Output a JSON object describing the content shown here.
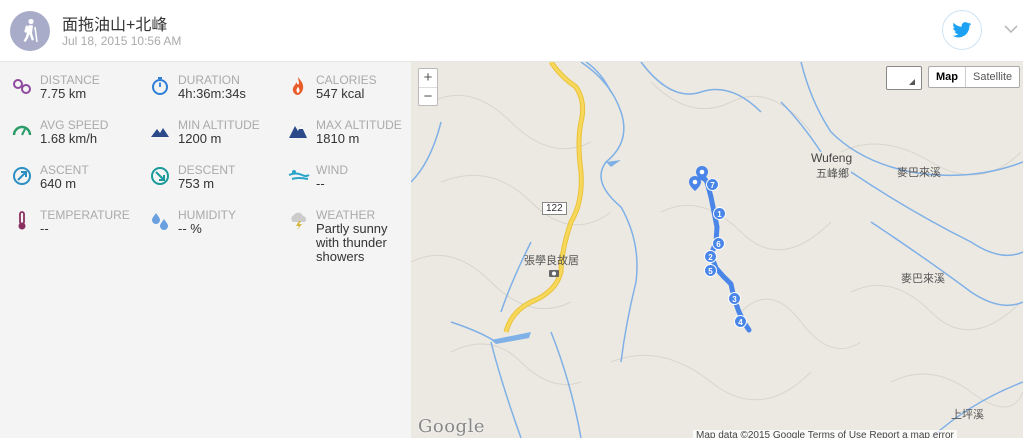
{
  "header": {
    "title": "面拖油山+北峰",
    "datetime": "Jul 18, 2015 10:56 AM",
    "avatar_icon": "hiker-icon",
    "share_icon": "twitter-icon",
    "menu_icon": "chevron-down-icon",
    "twitter_color": "#1da1f2"
  },
  "stats": [
    {
      "key": "distance",
      "label": "DISTANCE",
      "value": "7.75 km",
      "icon": "route-icon",
      "color": "#8e4a9e"
    },
    {
      "key": "duration",
      "label": "DURATION",
      "value": "4h:36m:34s",
      "icon": "stopwatch-icon",
      "color": "#2f7fd6"
    },
    {
      "key": "calories",
      "label": "CALORIES",
      "value": "547 kcal",
      "icon": "flame-icon",
      "color": "#e85d2a"
    },
    {
      "key": "avg_speed",
      "label": "AVG SPEED",
      "value": "1.68 km/h",
      "icon": "speedometer-icon",
      "color": "#2a9d6a"
    },
    {
      "key": "min_altitude",
      "label": "MIN ALTITUDE",
      "value": "1200 m",
      "icon": "mountain-low-icon",
      "color": "#2c4a8a"
    },
    {
      "key": "max_altitude",
      "label": "MAX ALTITUDE",
      "value": "1810 m",
      "icon": "mountain-high-icon",
      "color": "#2c4a8a"
    },
    {
      "key": "ascent",
      "label": "ASCENT",
      "value": "640 m",
      "icon": "ascent-icon",
      "color": "#2a8fc2"
    },
    {
      "key": "descent",
      "label": "DESCENT",
      "value": "753 m",
      "icon": "descent-icon",
      "color": "#1a9a9a"
    },
    {
      "key": "wind",
      "label": "WIND",
      "value": "--",
      "icon": "wind-icon",
      "color": "#2aa5c8"
    },
    {
      "key": "temperature",
      "label": "TEMPERATURE",
      "value": "--",
      "icon": "thermometer-icon",
      "color": "#8a3060"
    },
    {
      "key": "humidity",
      "label": "HUMIDITY",
      "value": "-- %",
      "icon": "humidity-icon",
      "color": "#6aa0e0"
    },
    {
      "key": "weather",
      "label": "WEATHER",
      "value": "Partly sunny with thunder showers",
      "icon": "thunder-cloud-icon",
      "color": "#d4b540"
    }
  ],
  "map": {
    "zoom_in": "+",
    "zoom_out": "−",
    "map_type_active": "Map",
    "map_type_other": "Satellite",
    "route_number": "122",
    "places": {
      "wufeng_en": "Wufeng",
      "wufeng_zh": "五峰鄉",
      "river1": "麥巴來溪",
      "river2": "麥巴來溪",
      "residence": "張學良故居",
      "creek_bottom": "上坪溪"
    },
    "markers": [
      "7",
      "1",
      "6",
      "2",
      "5",
      "3",
      "4"
    ],
    "logo": "Google",
    "attribution": "Map data ©2015 Google   Terms of Use   Report a map error",
    "route_color": "#4a86e8",
    "road_color": "#f5c842",
    "water_color": "#6fa3e0"
  }
}
